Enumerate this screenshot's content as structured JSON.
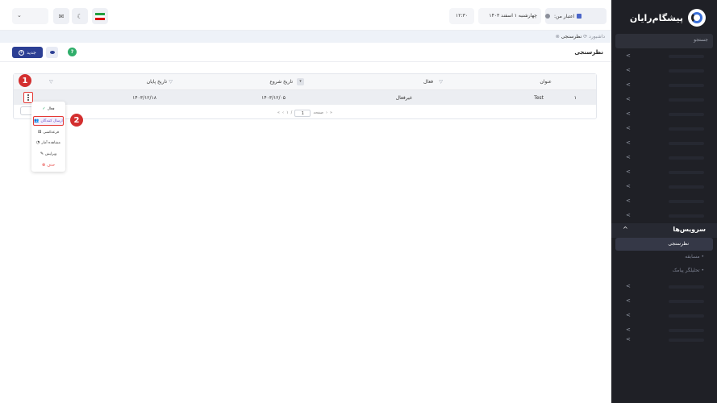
{
  "app": {
    "brand_name": "پیشگام‌رایان"
  },
  "sidebar": {
    "search_placeholder": "جستجو",
    "services_label": "سرویس‌ها",
    "submenu": [
      {
        "label": "نظرسنجی"
      },
      {
        "label": "مسابقه"
      },
      {
        "label": "تحلیلگر پیامک"
      }
    ]
  },
  "topbar": {
    "credit_label": "اعتبار من:",
    "date": "چهارشنبه ۱ اسفند ۱۴۰۳",
    "time": "۱۲:۳۰"
  },
  "breadcrumb": {
    "home": "داشبورد",
    "current": "نظرسنجی"
  },
  "page": {
    "title": "نظرسنجی",
    "new_button": "جدید"
  },
  "table": {
    "columns": [
      "عنوان",
      "فعال",
      "تاریخ شروع",
      "تاریخ پایان"
    ],
    "rows": [
      {
        "index": "۱",
        "title": "Test",
        "status": "غیرفعال",
        "start": "۱۴۰۳/۱۲/۰۵",
        "end": "۱۴۰۳/۱۲/۱۸"
      }
    ],
    "pager": {
      "page_label": "صفحه",
      "current_page": "1",
      "total_pages": "۱",
      "separator": "/"
    }
  },
  "action_menu": {
    "items": [
      {
        "label": "فعال",
        "icon": "check-icon"
      },
      {
        "label": "ارسال کنندگان",
        "icon": "users-icon"
      },
      {
        "label": "قرعه‌کشی",
        "icon": "dice-icon"
      },
      {
        "label": "مشاهده آمار",
        "icon": "chart-icon"
      },
      {
        "label": "ویرایش",
        "icon": "pencil-icon"
      },
      {
        "label": "حذف",
        "icon": "trash-icon"
      }
    ]
  },
  "annotations": {
    "step1": "1",
    "step2": "2"
  },
  "colors": {
    "sidebar_bg": "#1f2026",
    "primary": "#2c3f94",
    "highlight_red": "#e53935",
    "success": "#2fae6a"
  }
}
